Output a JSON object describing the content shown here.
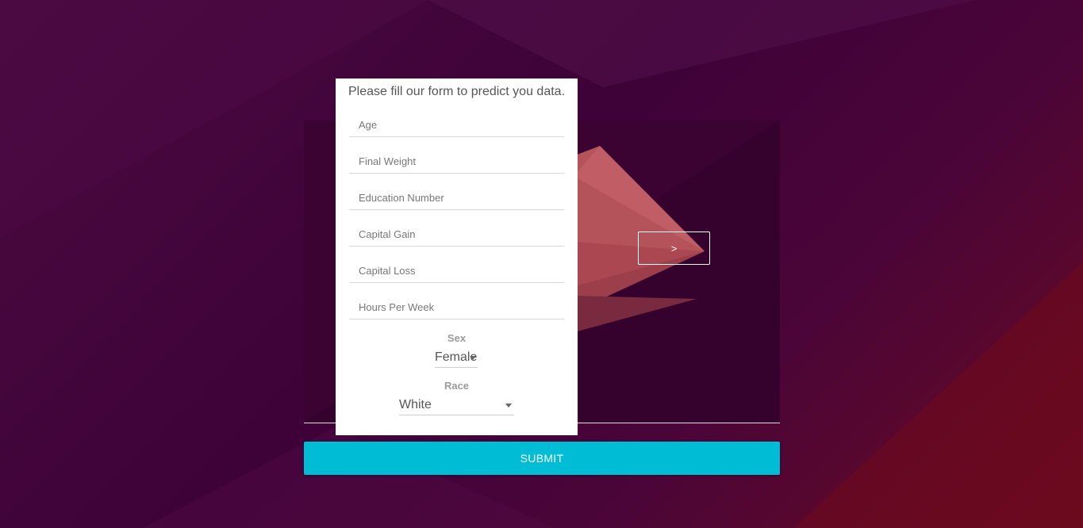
{
  "form": {
    "title": "Please fill our form to predict you data.",
    "fields": {
      "age": "Age",
      "final_weight": "Final Weight",
      "education_number": "Education Number",
      "capital_gain": "Capital Gain",
      "capital_loss": "Capital Loss",
      "hours_per_week": "Hours Per Week"
    },
    "sex": {
      "label": "Sex",
      "value": "Female"
    },
    "race": {
      "label": "Race",
      "value": "White"
    }
  },
  "buttons": {
    "next_label": ">",
    "submit_label": "SUBMIT"
  },
  "colors": {
    "background": "#3e0238",
    "panel": "#ffffff",
    "submit": "#00bcd4",
    "triangle_light": "#c4565a",
    "triangle_dark": "#8a3245"
  }
}
